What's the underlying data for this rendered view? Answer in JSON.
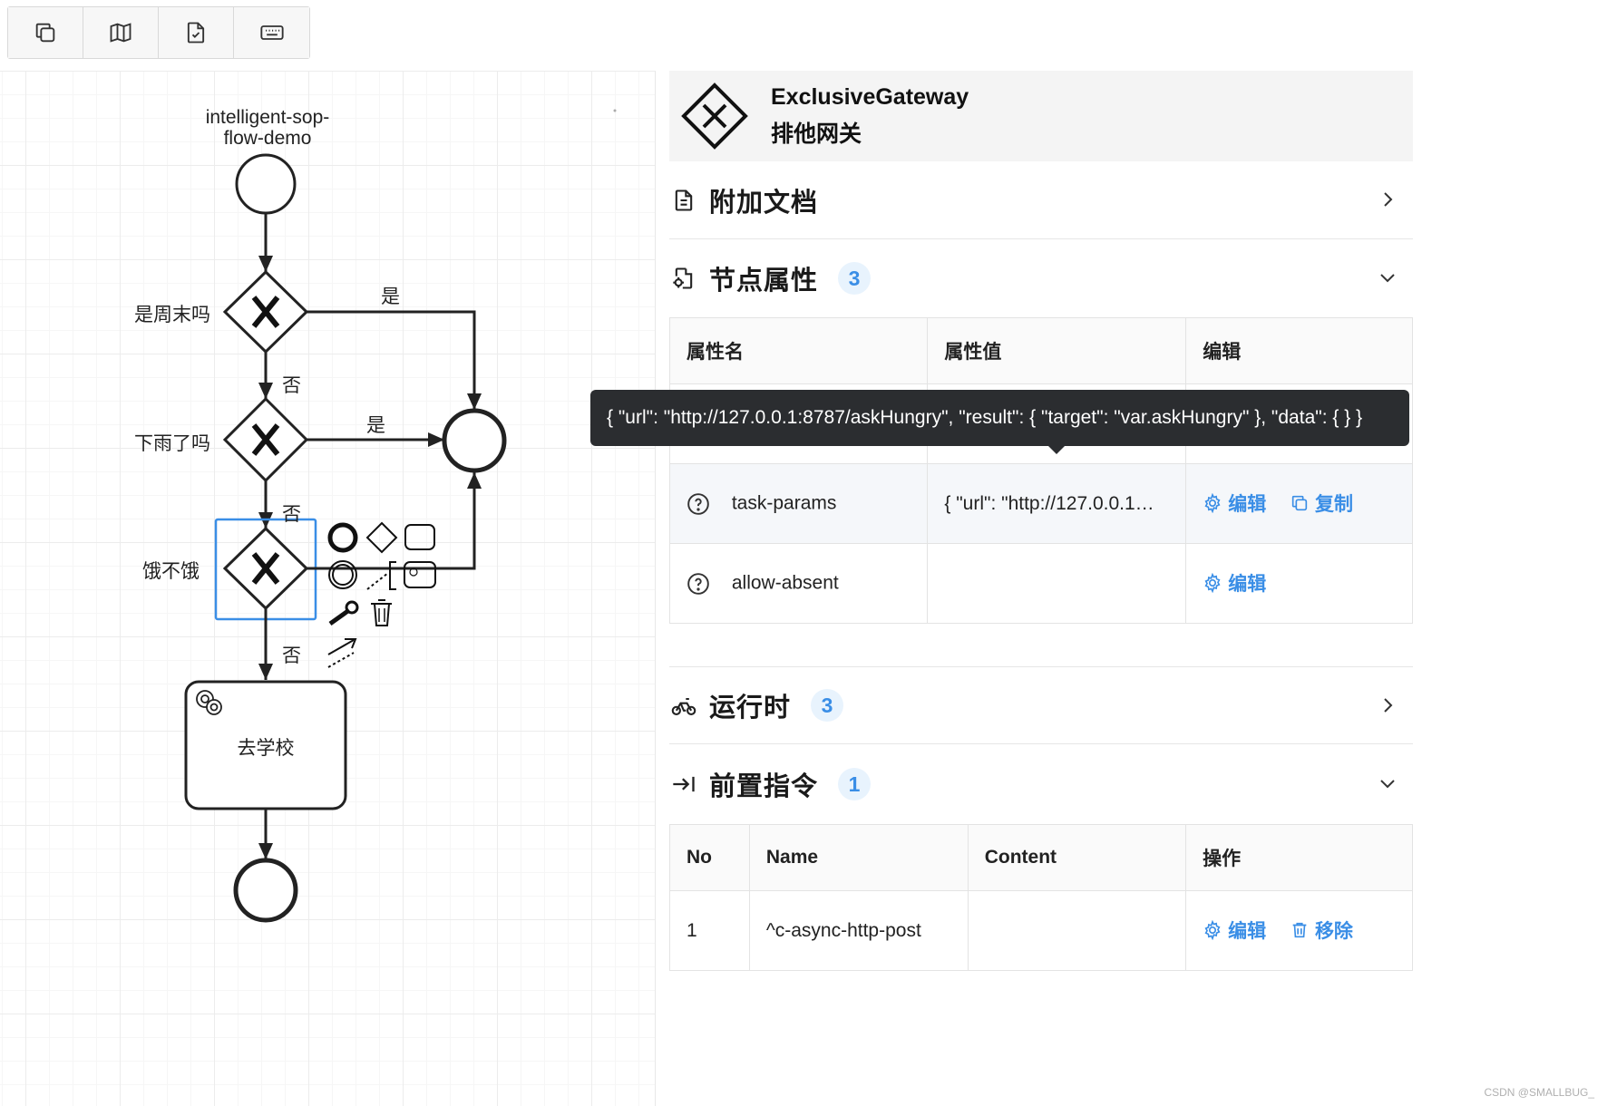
{
  "toolbar": {
    "buttons": [
      {
        "icon": "copy-icon"
      },
      {
        "icon": "map-icon"
      },
      {
        "icon": "file-check-icon"
      },
      {
        "icon": "keyboard-icon"
      }
    ]
  },
  "diagram": {
    "process_name": "intelligent-sop-flow-demo",
    "process_name_line1": "intelligent-sop-",
    "process_name_line2": "flow-demo",
    "gateways": [
      {
        "label": "是周末吗"
      },
      {
        "label": "下雨了吗"
      },
      {
        "label": "饿不饿"
      }
    ],
    "flow_labels": {
      "yes1": "是",
      "no1": "否",
      "yes2": "是",
      "no2": "否",
      "no3": "否"
    },
    "task": {
      "label": "去学校"
    }
  },
  "panel": {
    "element_type": "ExclusiveGateway",
    "element_type_cn": "排他网关",
    "sections": {
      "docs": {
        "title": "附加文档"
      },
      "props": {
        "title": "节点属性",
        "count": "3"
      },
      "runtime": {
        "title": "运行时",
        "count": "3"
      },
      "pre": {
        "title": "前置指令",
        "count": "1"
      }
    },
    "props_table": {
      "headers": [
        "属性名",
        "属性值",
        "编辑"
      ],
      "rows": [
        {
          "name": "task-params",
          "value": "{ \"url\": \"http://127.0.0.1…",
          "actions": [
            "编辑",
            "复制"
          ]
        },
        {
          "name": "allow-absent",
          "value": "",
          "actions": [
            "编辑"
          ]
        }
      ]
    },
    "tooltip": "{ \"url\": \"http://127.0.0.1:8787/askHungry\", \"result\": { \"target\": \"var.askHungry\" }, \"data\": { } }",
    "pre_table": {
      "headers": [
        "No",
        "Name",
        "Content",
        "操作"
      ],
      "rows": [
        {
          "no": "1",
          "name": "^c-async-http-post",
          "content": "",
          "actions": [
            "编辑",
            "移除"
          ]
        }
      ]
    }
  },
  "watermark": "CSDN @SMALLBUG_"
}
